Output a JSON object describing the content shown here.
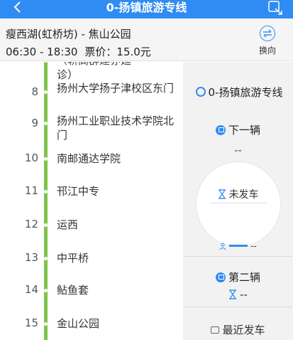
{
  "header": {
    "title": "0-扬镇旅游专线",
    "back_icon": "chevron-left-icon",
    "share_icon": "share-icon"
  },
  "route_info": {
    "route": "瘦西湖(虹桥坊) - 焦山公园",
    "hours": "06:30 - 18:30",
    "price": "票价：15.0元",
    "switch_label": "换向"
  },
  "stops": [
    {
      "num": "",
      "name": "（轿高群建亦延",
      "partial": true
    },
    {
      "num": "",
      "name": "诊）"
    },
    {
      "num": "8",
      "name": "扬州大学扬子津校区东门"
    },
    {
      "num": "9",
      "name": "扬州工业职业技术学院北门"
    },
    {
      "num": "10",
      "name": "南邮通达学院"
    },
    {
      "num": "11",
      "name": "邗江中专"
    },
    {
      "num": "12",
      "name": "运西"
    },
    {
      "num": "13",
      "name": "中平桥"
    },
    {
      "num": "14",
      "name": "鲇鱼套"
    },
    {
      "num": "15",
      "name": "金山公园"
    }
  ],
  "panel": {
    "line_name": "0-扬镇旅游专线",
    "next_label": "下一辆",
    "next_value": "--",
    "status": "未发车",
    "person_value": "--",
    "second_label": "第二辆",
    "second_value": "--",
    "latest_label": "最近发车"
  },
  "colors": {
    "accent": "#2f8cf2",
    "rail": "#7ec34a"
  }
}
